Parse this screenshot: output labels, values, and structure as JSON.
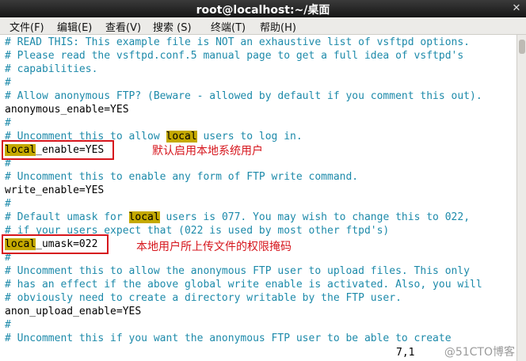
{
  "window": {
    "title": "root@localhost:~/桌面",
    "close_label": "✕"
  },
  "menu": [
    "文件(F)",
    "编辑(E)",
    "查看(V)",
    "搜索 (S)",
    "终端(T)",
    "帮助(H)"
  ],
  "lines": [
    "# READ THIS: This example file is NOT an exhaustive list of vsftpd options.",
    "# Please read the vsftpd.conf.5 manual page to get a full idea of vsftpd's",
    "# capabilities.",
    "#",
    "# Allow anonymous FTP? (Beware - allowed by default if you comment this out).",
    "anonymous_enable=YES",
    "#",
    "# Uncomment this to allow local users to log in.",
    "local_enable=YES",
    "#",
    "# Uncomment this to enable any form of FTP write command.",
    "write_enable=YES",
    "#",
    "# Default umask for local users is 077. You may wish to change this to 022,",
    "# if your users expect that (022 is used by most other ftpd's)",
    "local_umask=022",
    "#",
    "# Uncomment this to allow the anonymous FTP user to upload files. This only",
    "# has an effect if the above global write enable is activated. Also, you will",
    "# obviously need to create a directory writable by the FTP user.",
    "anon_upload_enable=YES",
    "#",
    "# Uncomment this if you want the anonymous FTP user to be able to create"
  ],
  "segments": {
    "l8_pre": "# Uncomment this to allow ",
    "l8_hl": "local",
    "l8_post": " users to log in.",
    "l9_hl": "local",
    "l9_post": "_enable=YES",
    "l14_pre": "# Default umask for ",
    "l14_hl": "local",
    "l14_post": " users is 077. You may wish to change this to 022,",
    "l16_hl": "local",
    "l16_post": "_umask=022"
  },
  "annotations": {
    "enable_note": "默认启用本地系统用户",
    "umask_note": "本地用户所上传文件的权限掩码"
  },
  "status": {
    "position": "7,1"
  },
  "watermark": "@51CTO博客"
}
